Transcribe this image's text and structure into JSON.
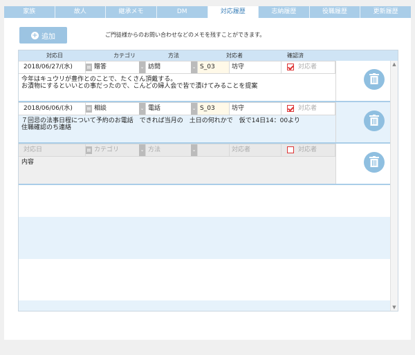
{
  "tabs": [
    {
      "label": "家族",
      "active": false
    },
    {
      "label": "故人",
      "active": false
    },
    {
      "label": "継承メモ",
      "active": false
    },
    {
      "label": "DM",
      "active": false
    },
    {
      "label": "対応履歴",
      "active": true
    },
    {
      "label": "志納履歴",
      "active": false
    },
    {
      "label": "役職履歴",
      "active": false
    },
    {
      "label": "更新履歴",
      "active": false
    }
  ],
  "toolbar": {
    "add_label": "追加",
    "notice": "ご門徒様からのお問い合わせなどのメモを残すことができます。"
  },
  "grid": {
    "columns": [
      "対応日",
      "カテゴリ",
      "方法",
      "対応者",
      "確認済"
    ],
    "records": [
      {
        "date": "2018/06/27/(水)",
        "category": "贈答",
        "method": "訪問",
        "code": "S_03",
        "person": "坊守",
        "checked": true,
        "confirmer_placeholder": "対応者",
        "content_lines": [
          "今年はキュウリが豊作とのことで、たくさん頂戴する。",
          "お漬物にするといいとの事だったので、こんどの婦人会で皆で漬けてみることを提案"
        ]
      },
      {
        "date": "2018/06/06/(水)",
        "category": "相談",
        "method": "電話",
        "code": "S_03",
        "person": "坊守",
        "checked": true,
        "confirmer_placeholder": "対応者",
        "content_lines": [
          "７回忌の法事日程について予約のお電話　できれば当月の　土日の何れかで　仮で14日14：00より",
          "住職確認のち連絡"
        ]
      }
    ],
    "new_record": {
      "date_placeholder": "対応日",
      "category_placeholder": "カテゴリ",
      "method_placeholder": "方法",
      "person_placeholder": "対応者",
      "confirmer_placeholder": "対応者",
      "content_placeholder": "内容"
    }
  },
  "colors": {
    "tab_inactive": "#a9cde8",
    "accent": "#8fbfe0",
    "band": "#e6f2fb",
    "check": "#dd3333"
  }
}
